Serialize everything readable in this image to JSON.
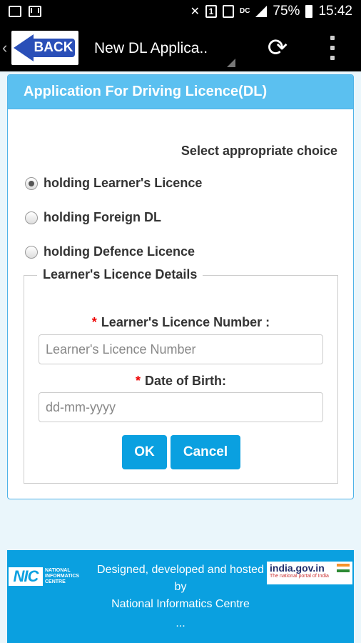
{
  "status_bar": {
    "sim_badge": "1",
    "network_label": "DC",
    "battery_percent": "75%",
    "time": "15:42",
    "left_icons": [
      "gallery-icon",
      "mail-icon"
    ],
    "right_icons": [
      "mute-icon",
      "sim-icon",
      "data-icon",
      "signal-icon",
      "battery-icon"
    ]
  },
  "app_bar": {
    "back_label": "BACK",
    "title": "New DL Applica..",
    "refresh_icon": "refresh-icon",
    "menu_icon": "overflow-menu-icon"
  },
  "panel": {
    "title": "Application For Driving Licence(DL)",
    "select_label": "Select appropriate choice",
    "options": [
      {
        "label": "holding Learner's Licence",
        "checked": true
      },
      {
        "label": "holding Foreign DL",
        "checked": false
      },
      {
        "label": "holding Defence Licence",
        "checked": false
      }
    ],
    "details": {
      "legend": "Learner's Licence Details",
      "required_mark": "*",
      "ll_number_label": "Learner's Licence Number :",
      "ll_number_placeholder": "Learner's Licence Number",
      "dob_label": "Date of Birth:",
      "dob_placeholder": "dd-mm-yyyy",
      "ok_label": "OK",
      "cancel_label": "Cancel"
    }
  },
  "footer": {
    "nic_mark": "NIC",
    "nic_text_line1": "NATIONAL",
    "nic_text_line2": "INFORMATICS",
    "nic_text_line3": "CENTRE",
    "line1": "Designed, developed and hosted",
    "line2": "by",
    "line3": "National Informatics Centre",
    "india_logo_name": "india.gov.in",
    "india_logo_sub": "The national portal of India",
    "more": "..."
  },
  "colors": {
    "header_blue": "#5bc0f0",
    "button_blue": "#0aa0e0",
    "required_red": "#ee0000",
    "back_arrow_blue": "#2a4fb8"
  }
}
